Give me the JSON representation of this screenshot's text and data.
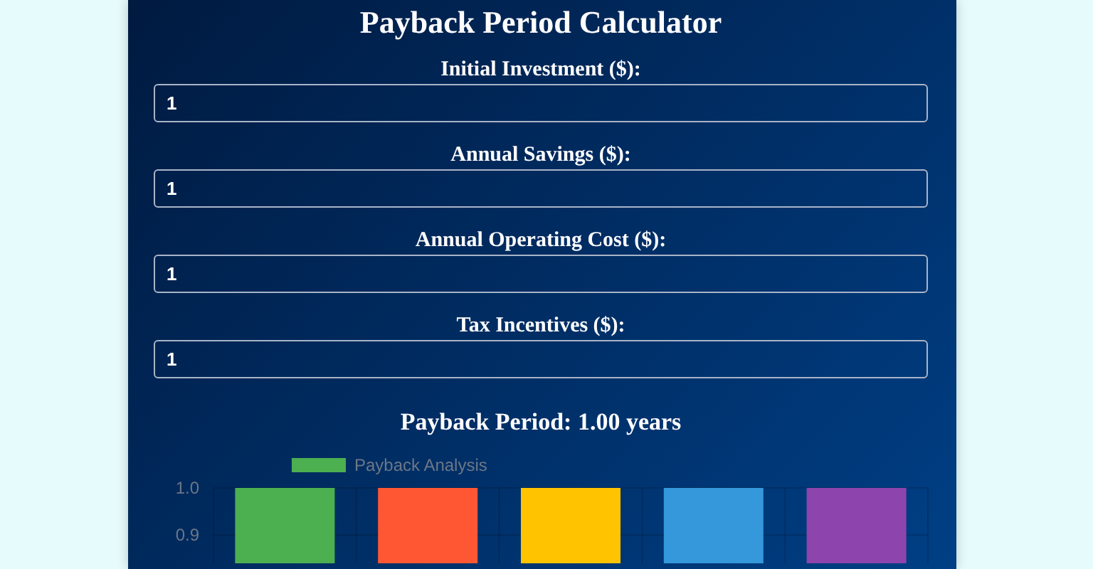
{
  "title": "Payback Period Calculator",
  "fields": [
    {
      "label": "Initial Investment ($):",
      "value": "1"
    },
    {
      "label": "Annual Savings ($):",
      "value": "1"
    },
    {
      "label": "Annual Operating Cost ($):",
      "value": "1"
    },
    {
      "label": "Tax Incentives ($):",
      "value": "1"
    }
  ],
  "result": "Payback Period: 1.00 years",
  "chart": {
    "chart_data": {
      "type": "bar",
      "series": [
        {
          "name": "Payback Analysis",
          "values": [
            1,
            1,
            1,
            1,
            1
          ]
        }
      ],
      "ylim": [
        0.84,
        1.0
      ],
      "yticks": [
        {
          "value": 1.0,
          "label": "1.0"
        },
        {
          "value": 0.9,
          "label": "0.9"
        }
      ]
    },
    "bars": [
      {
        "color": "#4caf50"
      },
      {
        "color": "#ff5733"
      },
      {
        "color": "#ffc300"
      },
      {
        "color": "#3498db"
      },
      {
        "color": "#8e44ad"
      }
    ]
  }
}
